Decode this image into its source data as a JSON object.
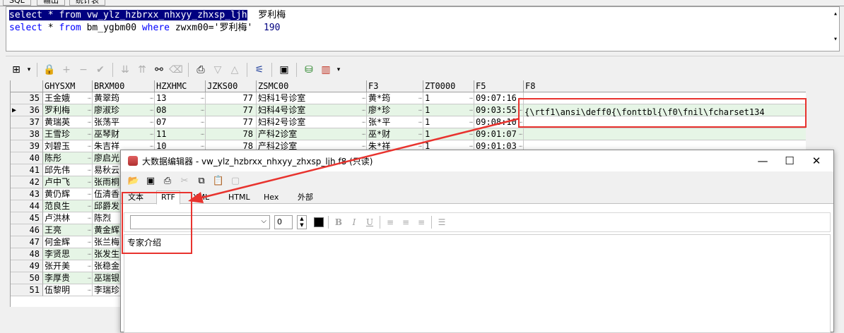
{
  "top_tabs": [
    "SQL",
    "输出",
    "统计表"
  ],
  "sql": {
    "line1_query": "select * from vw_ylz_hzbrxx_nhxyy_zhxsp_ljh",
    "line1_note": "罗利梅",
    "line2_kw1": "select",
    "line2_mid1": " * ",
    "line2_kw2": "from",
    "line2_mid2": " bm_ygbm00 ",
    "line2_kw3": "where",
    "line2_cond": " zwxm00='罗利梅'",
    "line2_num": "190"
  },
  "toolbar_icons": [
    "grid-icon",
    "lock-icon",
    "plus-icon",
    "minus-icon",
    "check-icon",
    "filter-down-icon",
    "filter-up-icon",
    "binoculars-icon",
    "eraser-icon",
    "print-icon",
    "triangle-down-icon",
    "triangle-up-icon",
    "tree-icon",
    "save-icon",
    "database-icon",
    "chart-icon"
  ],
  "grid": {
    "columns": [
      "GHYSXM",
      "BRXM00",
      "HZXHMC",
      "JZKS00",
      "ZSMC00",
      "F3",
      "ZT0000",
      "F5",
      "F8"
    ],
    "rows": [
      {
        "n": "35",
        "c": [
          "王金娥",
          "黄翠筠",
          "13",
          "77",
          "妇科1号诊室",
          "黄*筠",
          "1",
          "09:07:16",
          ""
        ]
      },
      {
        "n": "36",
        "c": [
          "罗利梅",
          "廖淑珍",
          "08",
          "77",
          "妇科4号诊室",
          "廖*珍",
          "1",
          "09:03:55",
          ""
        ],
        "current": true
      },
      {
        "n": "37",
        "c": [
          "黄瑞英",
          "张荡平",
          "07",
          "77",
          "妇科2号诊室",
          "张*平",
          "1",
          "09:08:10",
          ""
        ]
      },
      {
        "n": "38",
        "c": [
          "王雪珍",
          "巫琴财",
          "11",
          "78",
          "产科2诊室",
          "巫*财",
          "1",
          "09:01:07",
          ""
        ]
      },
      {
        "n": "39",
        "c": [
          "刘碧玉",
          "朱吉祥",
          "10",
          "78",
          "产科2诊室",
          "朱*祥",
          "1",
          "09:01:03",
          ""
        ]
      },
      {
        "n": "40",
        "c": [
          "陈彤",
          "廖启光",
          "",
          "",
          "",
          "",
          "",
          "",
          ""
        ]
      },
      {
        "n": "41",
        "c": [
          "邱先伟",
          "易秋云",
          "",
          "",
          "",
          "",
          "",
          "",
          ""
        ]
      },
      {
        "n": "42",
        "c": [
          "卢中飞",
          "张雨桐",
          "",
          "",
          "",
          "",
          "",
          "",
          ""
        ]
      },
      {
        "n": "43",
        "c": [
          "黄仍辉",
          "伍清香",
          "",
          "",
          "",
          "",
          "",
          "",
          ""
        ]
      },
      {
        "n": "44",
        "c": [
          "范良生",
          "邱爵发",
          "",
          "",
          "",
          "",
          "",
          "",
          ""
        ]
      },
      {
        "n": "45",
        "c": [
          "卢洪林",
          "陈烈",
          "",
          "",
          "",
          "",
          "",
          "",
          ""
        ]
      },
      {
        "n": "46",
        "c": [
          "王亮",
          "黄金辉",
          "",
          "",
          "",
          "",
          "",
          "",
          ""
        ]
      },
      {
        "n": "47",
        "c": [
          "何金辉",
          "张兰梅",
          "",
          "",
          "",
          "",
          "",
          "",
          ""
        ]
      },
      {
        "n": "48",
        "c": [
          "李贤思",
          "张发生",
          "",
          "",
          "",
          "",
          "",
          "",
          ""
        ]
      },
      {
        "n": "49",
        "c": [
          "张开美",
          "张稳金",
          "",
          "",
          "",
          "",
          "",
          "",
          ""
        ]
      },
      {
        "n": "50",
        "c": [
          "李厚贵",
          "巫瑞银",
          "",
          "",
          "",
          "",
          "",
          "",
          ""
        ]
      },
      {
        "n": "51",
        "c": [
          "伍黎明",
          "李瑞珍",
          "",
          "",
          "",
          "",
          "",
          "",
          ""
        ]
      }
    ],
    "f8_value": "{\\rtf1\\ansi\\deff0{\\fonttbl{\\f0\\fnil\\fcharset134"
  },
  "dialog": {
    "title": "大数据编辑器 - vw_ylz_hzbrxx_nhxyy_zhxsp_ljh.f8 (只读)",
    "minimize": "—",
    "maximize": "☐",
    "close": "✕",
    "tabs": [
      "文本",
      "RTF",
      "XML",
      "HTML",
      "Hex",
      "外部"
    ],
    "active_tab": "RTF",
    "font_size": "0",
    "content": "专家介绍"
  }
}
